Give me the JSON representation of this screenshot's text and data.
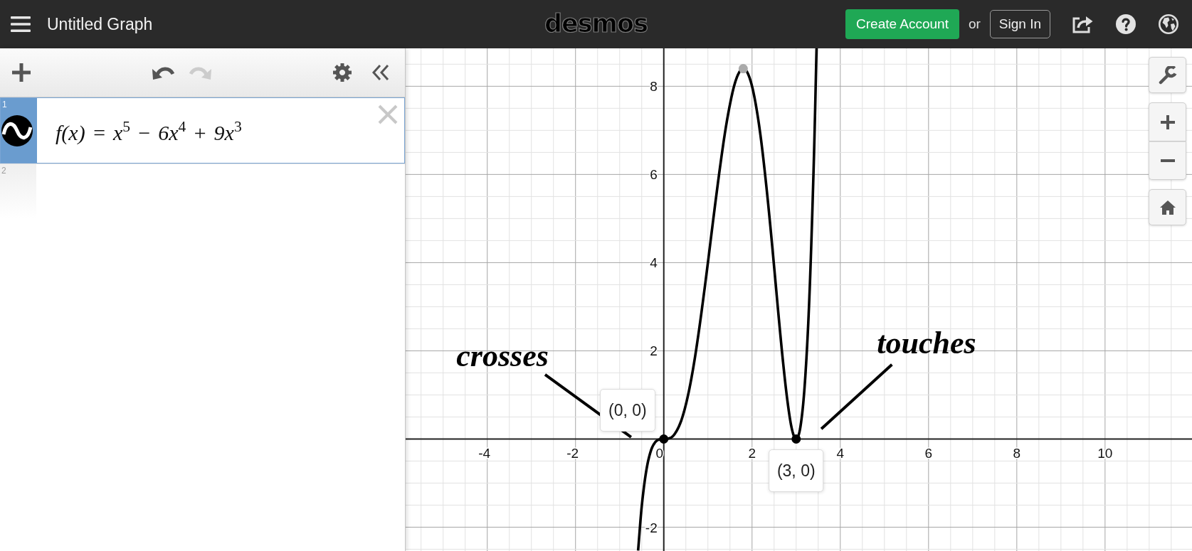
{
  "header": {
    "title": "Untitled Graph",
    "logo": "desmos",
    "create_account": "Create Account",
    "or": "or",
    "sign_in": "Sign In"
  },
  "toolbar": {
    "undo": {
      "disabled": false
    },
    "redo": {
      "disabled": true
    }
  },
  "expressions": [
    {
      "number": "1",
      "kind": "function",
      "expression": "f(x) = x$^{5}$ − 6x$^{4}$ + 9x$^{3}$",
      "selected": true
    },
    {
      "number": "2",
      "kind": "empty",
      "selected": false
    }
  ],
  "graph": {
    "chart_data": {
      "type": "line",
      "x": [
        -0.582,
        -0.5,
        -0.4,
        -0.3,
        -0.2,
        -0.1,
        0,
        0.1,
        0.2,
        0.3,
        0.4,
        0.5,
        0.6,
        0.7,
        0.8,
        0.9,
        1,
        1.1,
        1.2,
        1.3,
        1.4,
        1.5,
        1.6,
        1.7,
        1.8,
        1.9,
        2,
        2.1,
        2.2,
        2.3,
        2.4,
        2.5,
        2.6,
        2.7,
        2.8,
        2.9,
        3,
        3.1,
        3.2,
        3.3,
        3.4,
        3.462
      ],
      "series": [
        {
          "color": "#000000",
          "values": [
            -2.53,
            -1.53,
            -0.74,
            -0.29,
            -0.08,
            -0.01,
            0,
            0.01,
            0.06,
            0.2,
            0.43,
            0.78,
            1.24,
            1.81,
            2.48,
            3.22,
            4,
            4.81,
            5.6,
            6.35,
            7.03,
            7.59,
            8.03,
            8.3,
            8.4,
            8.3,
            8,
            7.5,
            6.82,
            5.96,
            4.98,
            3.91,
            2.81,
            1.77,
            0.88,
            0.24,
            0,
            0.3,
            1.31,
            3.23,
            6.29,
            8.86
          ]
        },
        {
          "color": "#000000",
          "marker": "circle",
          "values": [
            null,
            null,
            null,
            null,
            null,
            null,
            0,
            null,
            null,
            null,
            null,
            null,
            null,
            null,
            null,
            null,
            null,
            null,
            null,
            null,
            null,
            null,
            null,
            null,
            null,
            null,
            null,
            null,
            null,
            null,
            null,
            null,
            null,
            null,
            null,
            null,
            0,
            null,
            null,
            null,
            null,
            null
          ]
        },
        {
          "color": "#aaaaaa",
          "marker": "circle",
          "values": [
            null,
            null,
            null,
            null,
            null,
            null,
            null,
            null,
            null,
            null,
            null,
            null,
            null,
            null,
            null,
            null,
            null,
            null,
            null,
            null,
            null,
            null,
            null,
            null,
            8.4,
            null,
            null,
            null,
            null,
            null,
            null,
            null,
            null,
            null,
            null,
            null,
            null,
            null,
            null,
            null,
            null,
            null
          ]
        }
      ],
      "xlim": [
        -5.85,
        11.97
      ],
      "ylim": [
        -2.54,
        8.86
      ],
      "xticks": [
        {
          "value": -4,
          "label": "-4"
        },
        {
          "value": -2,
          "label": "-2"
        },
        {
          "value": 0,
          "label": "0"
        },
        {
          "value": 2,
          "label": "2"
        },
        {
          "value": 4,
          "label": "4"
        },
        {
          "value": 6,
          "label": "6"
        },
        {
          "value": 8,
          "label": "8"
        },
        {
          "value": 10,
          "label": "10"
        }
      ],
      "yticks": [
        {
          "value": -2,
          "label": "-2"
        },
        {
          "value": 2,
          "label": "2"
        },
        {
          "value": 4,
          "label": "4"
        },
        {
          "value": 6,
          "label": "6"
        },
        {
          "value": 8,
          "label": "8"
        }
      ],
      "annotations": [
        "crosses",
        "touches",
        "(0, 0)",
        "(3, 0)"
      ]
    }
  }
}
